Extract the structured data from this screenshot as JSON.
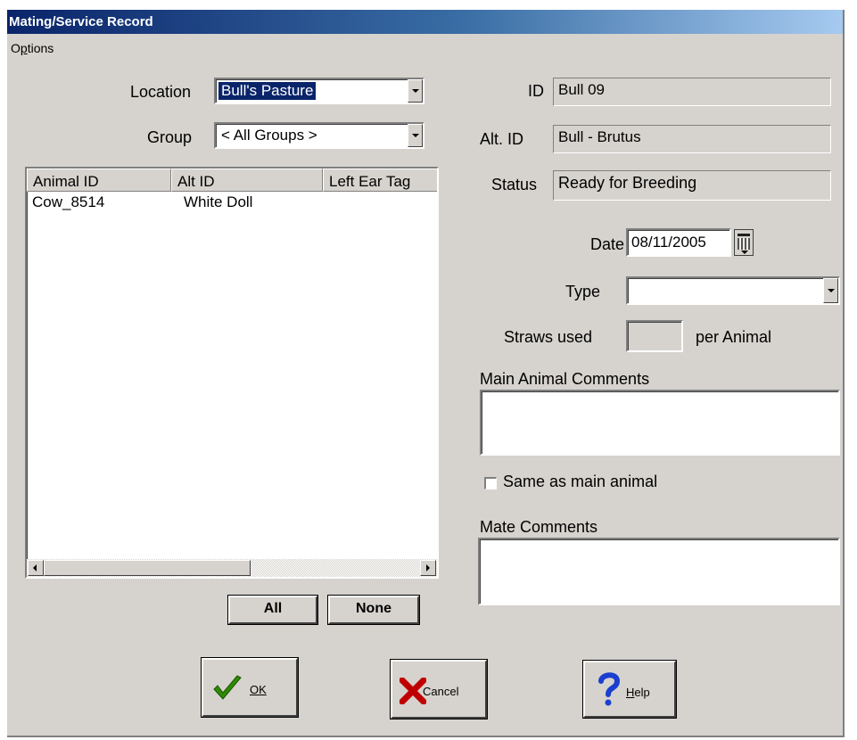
{
  "window": {
    "title": "Mating/Service Record"
  },
  "menu": {
    "options_label": "Options",
    "options_underline": "p"
  },
  "location": {
    "label": "Location",
    "value": "Bull's Pasture"
  },
  "group": {
    "label": "Group",
    "value": "< All Groups >"
  },
  "animal_list": {
    "columns": [
      "Animal ID",
      "Alt ID",
      "Left Ear Tag"
    ],
    "rows": [
      {
        "animal_id": "Cow_8514",
        "alt_id": "White Doll",
        "left_ear_tag": ""
      }
    ]
  },
  "list_buttons": {
    "all_label": "All",
    "none_label": "None"
  },
  "bull": {
    "id_label": "ID",
    "id_value": "Bull 09",
    "alt_id_label": "Alt. ID",
    "alt_id_value": "Bull - Brutus",
    "status_label": "Status",
    "status_value": "Ready for Breeding"
  },
  "date": {
    "label": "Date",
    "value": "08/11/2005"
  },
  "type": {
    "label": "Type",
    "value": ""
  },
  "straws": {
    "label": "Straws used",
    "value": "",
    "suffix": "per Animal"
  },
  "main_comments": {
    "label": "Main Animal Comments",
    "value": ""
  },
  "same_as_main": {
    "label": "Same as main animal",
    "checked": false
  },
  "mate_comments": {
    "label": "Mate Comments",
    "value": ""
  },
  "footer": {
    "ok_label": "OK",
    "cancel_label": "Cancel",
    "help_label": "Help"
  },
  "colors": {
    "title_bar": "#0a246a",
    "window_bg": "#d6d3ce",
    "selection": "#0a246a",
    "ok_check": "#2e8b00",
    "cancel_x": "#c00000",
    "help_q": "#1a3fd0"
  }
}
